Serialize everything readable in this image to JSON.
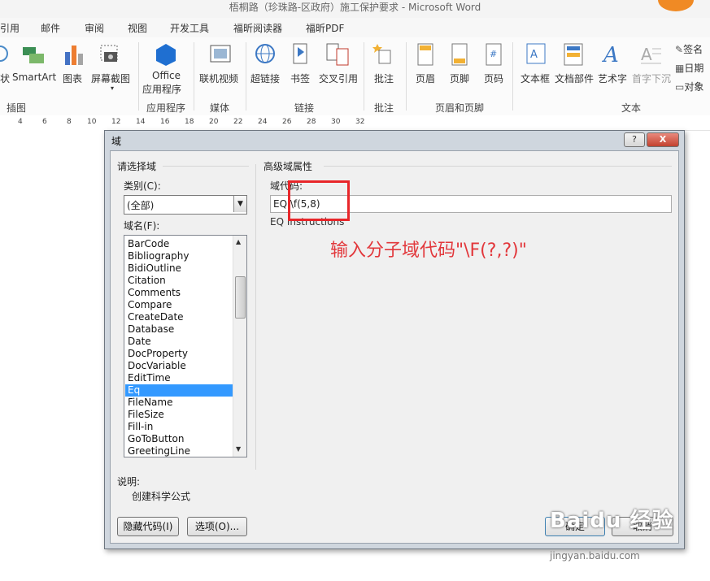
{
  "window": {
    "title": "梧桐路（珍珠路-区政府）施工保护要求 - Microsoft Word"
  },
  "ribbon_tabs": [
    "引用",
    "邮件",
    "审阅",
    "视图",
    "开发工具",
    "福昕阅读器",
    "福昕PDF"
  ],
  "ribbon": {
    "buttons": {
      "smartart": "SmartArt",
      "chart": "图表",
      "screenshot": "屏幕截图",
      "office_apps_line1": "Office",
      "office_apps_line2": "应用程序",
      "online_video": "联机视频",
      "hyperlink": "超链接",
      "bookmark": "书签",
      "cross_ref": "交叉引用",
      "comment": "批注",
      "header": "页眉",
      "footer": "页脚",
      "page_number": "页码",
      "textbox": "文本框",
      "quick_parts": "文档部件",
      "wordart": "艺术字",
      "drop_cap": "首字下沉",
      "signature": "签名",
      "datetime": "日期",
      "object": "对象"
    },
    "groups": {
      "illustrations": "插图",
      "apps": "应用程序",
      "media": "媒体",
      "links": "链接",
      "comments": "批注",
      "header_footer": "页眉和页脚",
      "text": "文本"
    }
  },
  "ruler": [
    "4",
    "6",
    "8",
    "10",
    "12",
    "14",
    "16",
    "18",
    "20",
    "22",
    "24",
    "26",
    "28",
    "30",
    "32"
  ],
  "dialog": {
    "title": "域",
    "help_button": "?",
    "close_button": "X",
    "left_section": "请选择域",
    "category_label": "类别(C):",
    "category_value": "(全部)",
    "field_names_label": "域名(F):",
    "field_list": [
      "BarCode",
      "Bibliography",
      "BidiOutline",
      "Citation",
      "Comments",
      "Compare",
      "CreateDate",
      "Database",
      "Date",
      "DocProperty",
      "DocVariable",
      "EditTime",
      "Eq",
      "FileName",
      "FileSize",
      "Fill-in",
      "GoToButton",
      "GreetingLine"
    ],
    "selected_field": "Eq",
    "right_section": "高级域属性",
    "field_codes_label": "域代码:",
    "field_code_value": "EQ \\f(5,8)",
    "field_code_hint": "EQ Instructions",
    "description_label": "说明:",
    "description_text": "创建科学公式",
    "hide_codes_button": "隐藏代码(I)",
    "options_button": "选项(O)...",
    "ok_button": "确定",
    "cancel_button": "取消"
  },
  "annotation": "输入分子域代码\"\\F(?,?)\"",
  "watermark": {
    "brand": "Baidu 经验",
    "url": "jingyan.baidu.com"
  }
}
